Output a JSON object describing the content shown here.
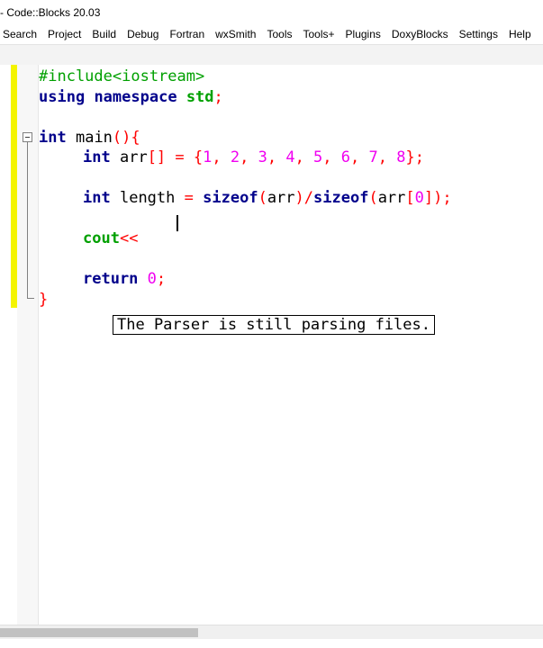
{
  "window": {
    "title": "- Code::Blocks 20.03"
  },
  "menu": [
    "Search",
    "Project",
    "Build",
    "Debug",
    "Fortran",
    "wxSmith",
    "Tools",
    "Tools+",
    "Plugins",
    "DoxyBlocks",
    "Settings",
    "Help"
  ],
  "code": {
    "l1": {
      "text": "#include<iostream>"
    },
    "l2": {
      "kw1": "using",
      "kw2": "namespace",
      "id": "std",
      "semi": ";"
    },
    "l4": {
      "kw": "int",
      "id": "main",
      "op": "(){"
    },
    "l5": {
      "kw": "int",
      "id": "arr",
      "op1": "[] = {",
      "n1": "1",
      "c1": ", ",
      "n2": "2",
      "c2": ", ",
      "n3": "3",
      "c3": ", ",
      "n4": "4",
      "c4": ", ",
      "n5": "5",
      "c5": ", ",
      "n6": "6",
      "c6": ", ",
      "n7": "7",
      "c7": ", ",
      "n8": "8",
      "end": "};"
    },
    "l7": {
      "kw": "int",
      "id": "length",
      "op1": "=",
      "kw2": "sizeof",
      "op2": "(",
      "id2": "arr",
      "op3": ")/",
      "kw3": "sizeof",
      "op4": "(",
      "id3": "arr",
      "op5": "[",
      "n": "0",
      "op6": "]);"
    },
    "l9": {
      "id": "cout",
      "op": "<<"
    },
    "l11": {
      "kw": "return",
      "n": "0",
      "semi": ";"
    },
    "l12": {
      "op": "}"
    }
  },
  "tooltip": "The Parser is still parsing files."
}
